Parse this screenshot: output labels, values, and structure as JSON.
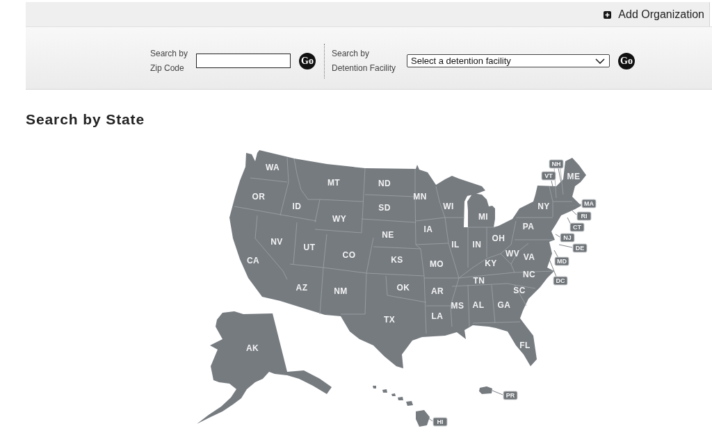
{
  "toolbar": {
    "add_link": "Add Organization"
  },
  "search_bar": {
    "zip": {
      "label": "Search by Zip Code",
      "button": "Go"
    },
    "facility": {
      "label": "Search by Detention Facility",
      "select_value": "Select a detention facility",
      "button": "Go"
    }
  },
  "state_search": {
    "title": "Search by State",
    "states": [
      {
        "abbr": "WA",
        "kind": "label"
      },
      {
        "abbr": "NH",
        "kind": "callout"
      },
      {
        "abbr": "VT",
        "kind": "callout"
      },
      {
        "abbr": "ME",
        "kind": "label"
      },
      {
        "abbr": "MT",
        "kind": "label"
      },
      {
        "abbr": "ND",
        "kind": "label"
      },
      {
        "abbr": "OR",
        "kind": "label"
      },
      {
        "abbr": "MN",
        "kind": "label"
      },
      {
        "abbr": "ID",
        "kind": "label"
      },
      {
        "abbr": "SD",
        "kind": "label"
      },
      {
        "abbr": "WI",
        "kind": "label"
      },
      {
        "abbr": "NY",
        "kind": "label"
      },
      {
        "abbr": "MA",
        "kind": "callout"
      },
      {
        "abbr": "WY",
        "kind": "label"
      },
      {
        "abbr": "MI",
        "kind": "label"
      },
      {
        "abbr": "RI",
        "kind": "callout"
      },
      {
        "abbr": "IA",
        "kind": "label"
      },
      {
        "abbr": "PA",
        "kind": "label"
      },
      {
        "abbr": "CT",
        "kind": "callout"
      },
      {
        "abbr": "NE",
        "kind": "label"
      },
      {
        "abbr": "NV",
        "kind": "label"
      },
      {
        "abbr": "OH",
        "kind": "label"
      },
      {
        "abbr": "NJ",
        "kind": "callout"
      },
      {
        "abbr": "UT",
        "kind": "label"
      },
      {
        "abbr": "IL",
        "kind": "label"
      },
      {
        "abbr": "IN",
        "kind": "label"
      },
      {
        "abbr": "DE",
        "kind": "callout"
      },
      {
        "abbr": "CO",
        "kind": "label"
      },
      {
        "abbr": "WV",
        "kind": "label"
      },
      {
        "abbr": "CA",
        "kind": "label"
      },
      {
        "abbr": "KS",
        "kind": "label"
      },
      {
        "abbr": "VA",
        "kind": "label"
      },
      {
        "abbr": "MO",
        "kind": "label"
      },
      {
        "abbr": "KY",
        "kind": "label"
      },
      {
        "abbr": "MD",
        "kind": "callout"
      },
      {
        "abbr": "NC",
        "kind": "label"
      },
      {
        "abbr": "TN",
        "kind": "label"
      },
      {
        "abbr": "DC",
        "kind": "callout"
      },
      {
        "abbr": "AZ",
        "kind": "label"
      },
      {
        "abbr": "NM",
        "kind": "label"
      },
      {
        "abbr": "OK",
        "kind": "label"
      },
      {
        "abbr": "AR",
        "kind": "label"
      },
      {
        "abbr": "SC",
        "kind": "label"
      },
      {
        "abbr": "MS",
        "kind": "label"
      },
      {
        "abbr": "AL",
        "kind": "label"
      },
      {
        "abbr": "GA",
        "kind": "label"
      },
      {
        "abbr": "TX",
        "kind": "label"
      },
      {
        "abbr": "LA",
        "kind": "label"
      },
      {
        "abbr": "AK",
        "kind": "label"
      },
      {
        "abbr": "FL",
        "kind": "label"
      },
      {
        "abbr": "PR",
        "kind": "callout"
      },
      {
        "abbr": "HI",
        "kind": "callout"
      }
    ]
  }
}
